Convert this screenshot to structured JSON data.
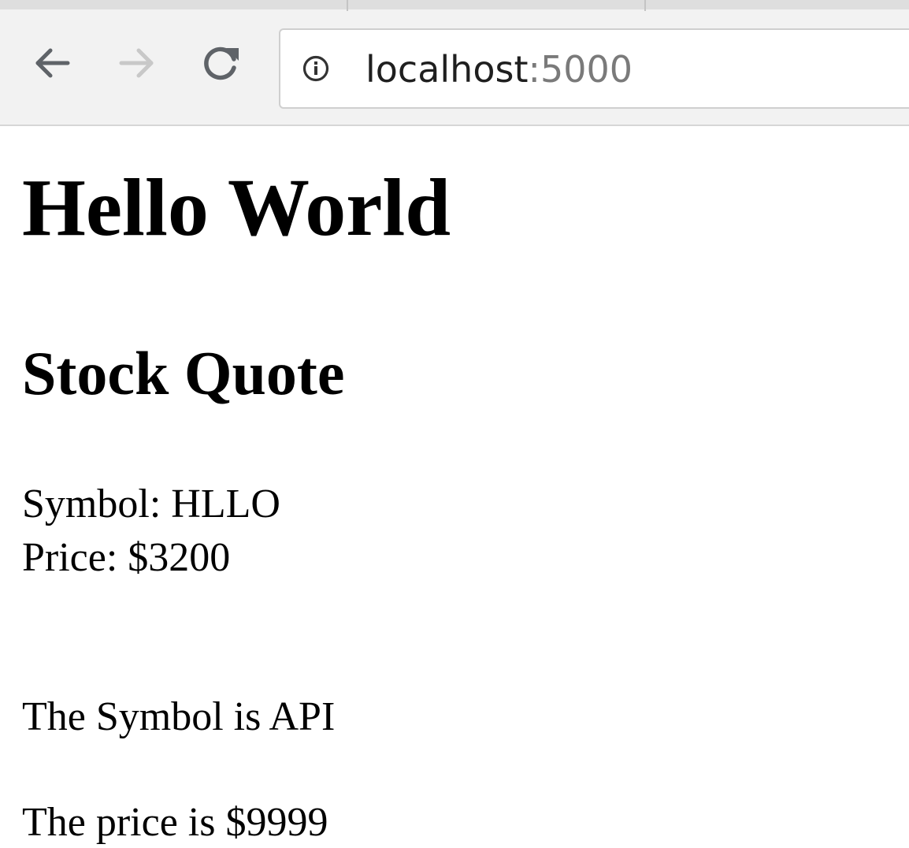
{
  "browser": {
    "url_host": "localhost",
    "url_port": ":5000",
    "icons": {
      "back": "arrow-left-icon",
      "forward": "arrow-right-icon",
      "reload": "reload-icon",
      "info": "info-icon"
    },
    "colors": {
      "icon_active": "#5f6368",
      "icon_disabled": "#c8c8c8"
    }
  },
  "page": {
    "title": "Hello World",
    "subtitle": "Stock Quote",
    "symbol_line": "Symbol: HLLO",
    "price_line": "Price: $3200",
    "api_symbol_line": "The Symbol is API",
    "api_price_line": "The price is $9999"
  }
}
